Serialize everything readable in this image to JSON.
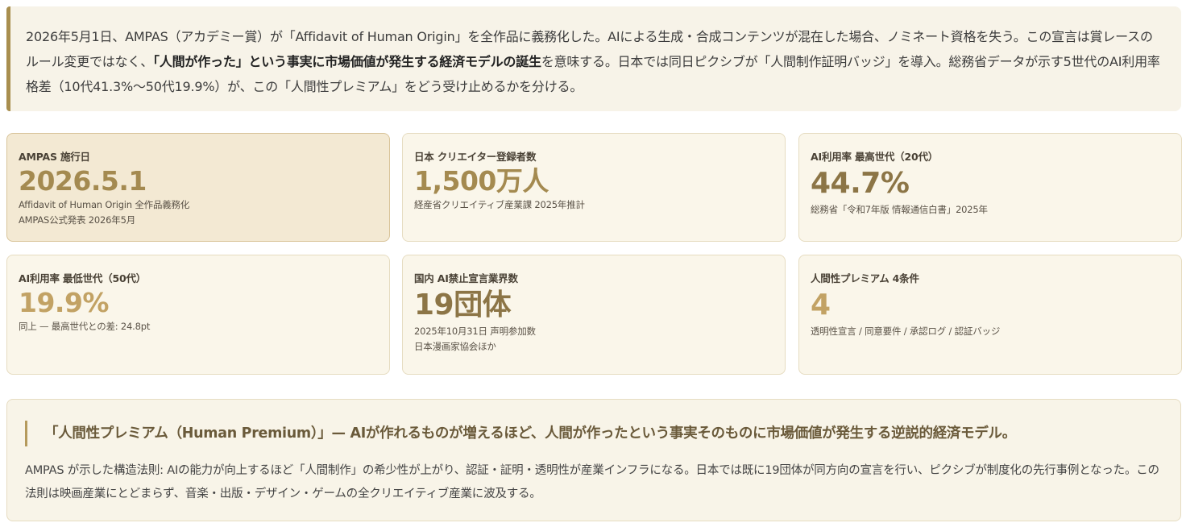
{
  "intro": {
    "part1": "2026年5月1日、AMPAS（アカデミー賞）が「Affidavit of Human Origin」を全作品に義務化した。AIによる生成・合成コンテンツが混在した場合、ノミネート資格を失う。この宣言は賞レースのルール変更ではなく、",
    "bold": "「人間が作った」という事実に市場価値が発生する経済モデルの誕生",
    "part2": "を意味する。日本では同日ピクシブが「人間制作証明バッジ」を導入。総務省データが示す5世代のAI利用率格差（10代41.3%〜50代19.9%）が、この「人間性プレミアム」をどう受け止めるかを分ける。"
  },
  "cards": [
    {
      "label": "AMPAS 施行日",
      "value": "2026.5.1",
      "note1": "Affidavit of Human Origin 全作品義務化",
      "note2": "AMPAS公式発表 2026年5月"
    },
    {
      "label": "日本 クリエイター登録者数",
      "value": "1,500万人",
      "note1": "経産省クリエイティブ産業課 2025年推計"
    },
    {
      "label": "AI利用率 最高世代（20代）",
      "value": "44.7%",
      "note1": "総務省「令和7年版 情報通信白書」2025年"
    },
    {
      "label": "AI利用率 最低世代（50代）",
      "value": "19.9%",
      "note1": "同上 — 最高世代との差: 24.8pt"
    },
    {
      "label": "国内 AI禁止宣言業界数",
      "value": "19団体",
      "note1": "2025年10月31日 声明参加数",
      "note2": "日本漫画家協会ほか"
    },
    {
      "label": "人間性プレミアム 4条件",
      "value": "4",
      "note1": "透明性宣言 / 同意要件 / 承認ログ / 認証バッジ"
    }
  ],
  "summary": {
    "heading": "「人間性プレミアム（Human Premium）」— AIが作れるものが増えるほど、人間が作ったという事実そのものに市場価値が発生する逆説的経済モデル。",
    "body": "AMPAS が示した構造法則: AIの能力が向上するほど「人間制作」の希少性が上がり、認証・証明・透明性が産業インフラになる。日本では既に19団体が同方向の宣言を行い、ピクシブが制度化の先行事例となった。この法則は映画産業にとどまらず、音楽・出版・デザイン・ゲームの全クリエイティブ産業に波及する。"
  },
  "colors": {
    "accent": "#a88e4e",
    "panel": "#f7f3e8",
    "value": "#a48a50"
  }
}
